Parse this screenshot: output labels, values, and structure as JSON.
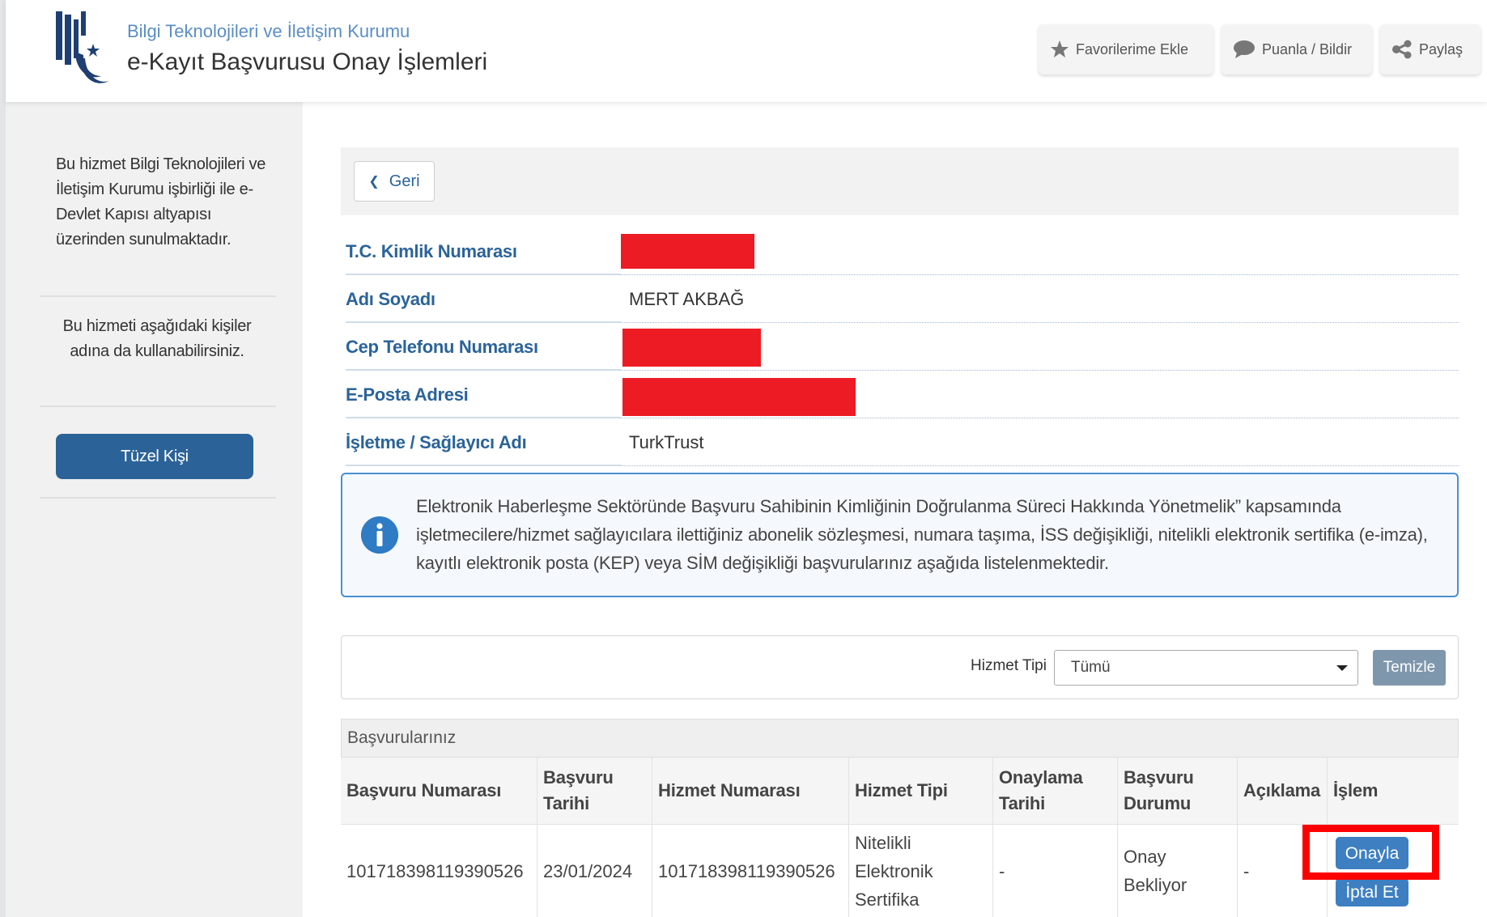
{
  "header": {
    "org_name": "Bilgi Teknolojileri ve İletişim Kurumu",
    "page_title": "e-Kayıt Başvurusu Onay İşlemleri",
    "favorites_label": "Favorilerime Ekle",
    "rate_label": "Puanla / Bildir",
    "share_label": "Paylaş"
  },
  "sidebar": {
    "service_note": "Bu hizmet Bilgi Teknolojileri ve İletişim Kurumu işbirliği ile e-Devlet Kapısı altyapısı üzerinden sunulmaktadır.",
    "other_persons_note": "Bu hizmeti aşağıdaki kişiler adına da kullanabilirsiniz.",
    "legal_entity_button": "Tüzel Kişi"
  },
  "back_button": {
    "label": "Geri"
  },
  "info": {
    "tc_label": "T.C. Kimlik Numarası",
    "name_label": "Adı Soyadı",
    "name_value": "MERT AKBAĞ",
    "phone_label": "Cep Telefonu Numarası",
    "email_label": "E-Posta Adresi",
    "provider_label": "İşletme / Sağlayıcı Adı",
    "provider_value": "TurkTrust"
  },
  "notice": {
    "text": "Elektronik Haberleşme Sektöründe Başvuru Sahibinin Kimliğinin Doğrulanma Süreci Hakkında Yönetmelik” kapsamında işletmecilere/hizmet sağlayıcılara ilettiğiniz abonelik sözleşmesi, numara taşıma, İSS değişikliği, nitelikli elektronik sertifika (e-imza), kayıtlı elektronik posta (KEP) veya SİM değişikliği başvurularınız aşağıda listelenmektedir."
  },
  "filter": {
    "label": "Hizmet Tipi",
    "selected": "Tümü",
    "clear_button": "Temizle"
  },
  "table": {
    "caption": "Başvurularınız",
    "headers": {
      "application_number": "Başvuru Numarası",
      "application_date": "Başvuru Tarihi",
      "service_number": "Hizmet Numarası",
      "service_type": "Hizmet Tipi",
      "approval_date": "Onaylama Tarihi",
      "application_status": "Başvuru Durumu",
      "description": "Açıklama",
      "action": "İşlem"
    },
    "rows": [
      {
        "application_number": "101718398119390526",
        "application_date": "23/01/2024",
        "service_number": "101718398119390526",
        "service_type": "Nitelikli Elektronik Sertifika",
        "approval_date": "-",
        "application_status": "Onay Bekliyor",
        "description": "-",
        "approve_label": "Onayla",
        "cancel_label": "İptal Et"
      }
    ]
  },
  "colors": {
    "brand_blue": "#2b6399",
    "action_blue": "#3d7fc1",
    "redaction_red": "#ed1c24",
    "highlight_red": "#ff0000"
  }
}
